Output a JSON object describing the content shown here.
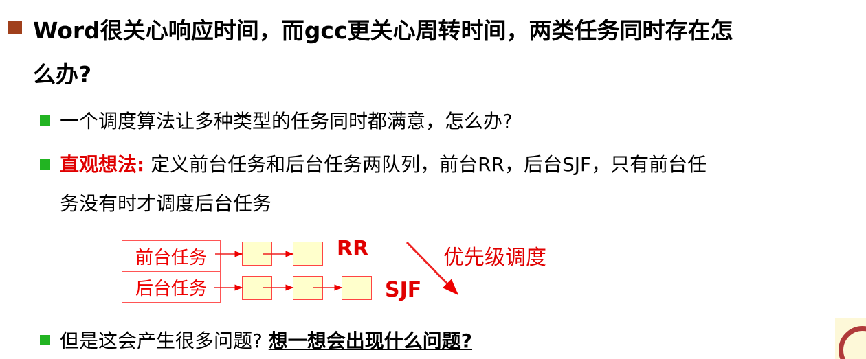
{
  "bullet1": {
    "line1": "Word很关心响应时间，而gcc更关心周转时间，两类任务同时存在怎",
    "line2": "么办?"
  },
  "sub1": "一个调度算法让多种类型的任务同时都满意，怎么办?",
  "sub2": {
    "label": "直观想法:",
    "line1": " 定义前台任务和后台任务两队列，前台RR，后台SJF，只有前台任",
    "line2": "务没有时才调度后台任务"
  },
  "diagram": {
    "fg": "前台任务",
    "bg": "后台任务",
    "rr": "RR",
    "sjf": "SJF",
    "priority": "优先级调度"
  },
  "sub3": {
    "text": "但是这会产生很多问题? ",
    "link": "想一想会出现什么问题?"
  },
  "colors": {
    "accent": "#e00000",
    "bullet1": "#a0401c",
    "bullet2": "#22b422"
  }
}
